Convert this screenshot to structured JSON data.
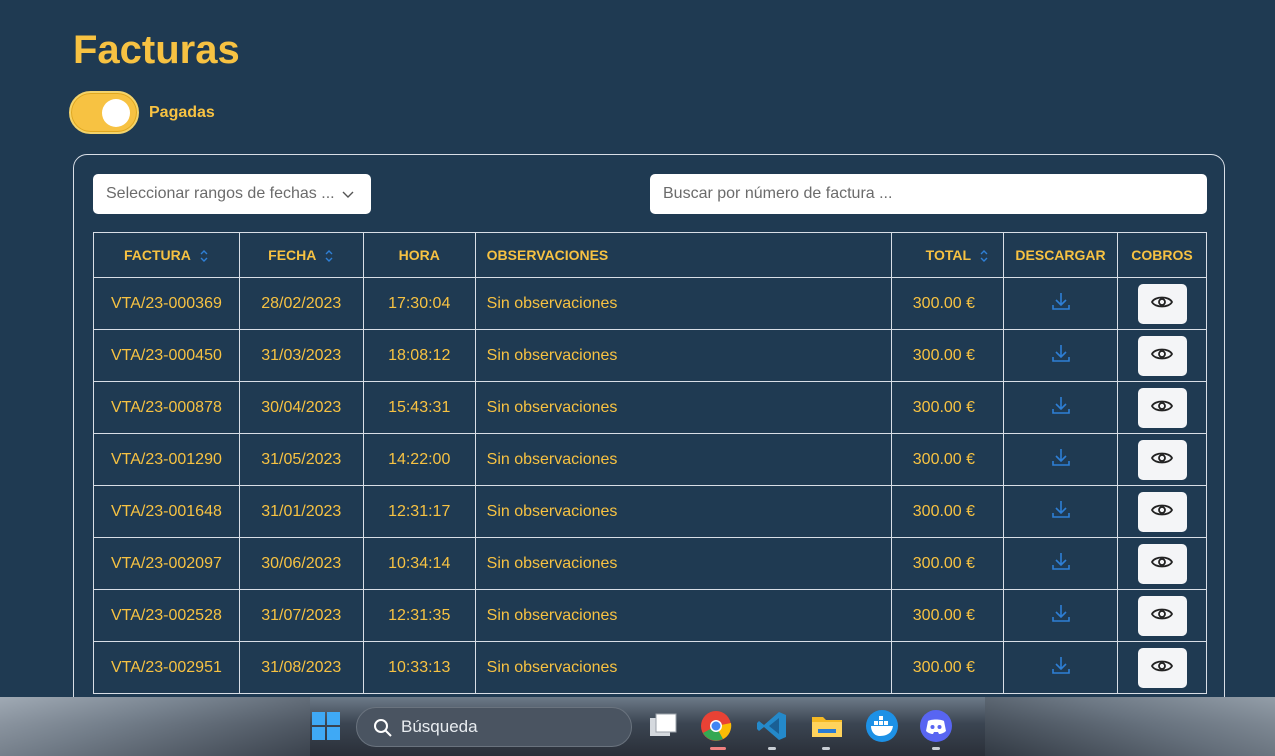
{
  "header": {
    "title": "Facturas"
  },
  "toggle": {
    "label": "Pagadas",
    "on": true
  },
  "filters": {
    "date_placeholder": "Seleccionar rangos de fechas ...",
    "search_placeholder": "Buscar por número de factura ..."
  },
  "table": {
    "columns": [
      "FACTURA",
      "FECHA",
      "HORA",
      "OBSERVACIONES",
      "TOTAL",
      "DESCARGAR",
      "COBROS"
    ],
    "rows": [
      {
        "factura": "VTA/23-000369",
        "fecha": "28/02/2023",
        "hora": "17:30:04",
        "obs": "Sin observaciones",
        "total": "300.00 €"
      },
      {
        "factura": "VTA/23-000450",
        "fecha": "31/03/2023",
        "hora": "18:08:12",
        "obs": "Sin observaciones",
        "total": "300.00 €"
      },
      {
        "factura": "VTA/23-000878",
        "fecha": "30/04/2023",
        "hora": "15:43:31",
        "obs": "Sin observaciones",
        "total": "300.00 €"
      },
      {
        "factura": "VTA/23-001290",
        "fecha": "31/05/2023",
        "hora": "14:22:00",
        "obs": "Sin observaciones",
        "total": "300.00 €"
      },
      {
        "factura": "VTA/23-001648",
        "fecha": "31/01/2023",
        "hora": "12:31:17",
        "obs": "Sin observaciones",
        "total": "300.00 €"
      },
      {
        "factura": "VTA/23-002097",
        "fecha": "30/06/2023",
        "hora": "10:34:14",
        "obs": "Sin observaciones",
        "total": "300.00 €"
      },
      {
        "factura": "VTA/23-002528",
        "fecha": "31/07/2023",
        "hora": "12:31:35",
        "obs": "Sin observaciones",
        "total": "300.00 €"
      },
      {
        "factura": "VTA/23-002951",
        "fecha": "31/08/2023",
        "hora": "10:33:13",
        "obs": "Sin observaciones",
        "total": "300.00 €"
      }
    ]
  },
  "taskbar": {
    "search_label": "Búsqueda",
    "apps": [
      "windows-start-icon",
      "task-view-icon",
      "chrome-icon",
      "vscode-icon",
      "file-explorer-icon",
      "docker-icon",
      "discord-icon"
    ]
  },
  "colors": {
    "background": "#1f3a52",
    "accent": "#f7c242",
    "link_blue": "#2e7fd6"
  }
}
